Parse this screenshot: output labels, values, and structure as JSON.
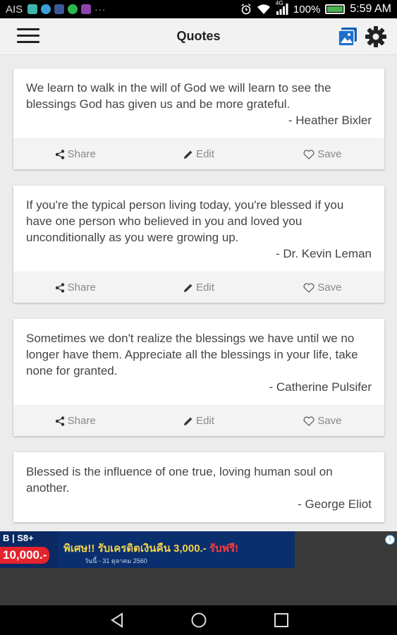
{
  "status_bar": {
    "carrier": "AIS",
    "signal_type": "4G",
    "battery": "100%",
    "time": "5:59 AM"
  },
  "app_bar": {
    "title": "Quotes"
  },
  "actions": {
    "share": "Share",
    "edit": "Edit",
    "save": "Save"
  },
  "quotes": [
    {
      "text": "We learn to walk in the will of God we will learn to see the blessings God has given us and be more grateful.",
      "author": "- Heather Bixler"
    },
    {
      "text": "If you're the typical person living today, you're blessed if you have one person who believed in you and loved you unconditionally as you were growing up.",
      "author": "- Dr. Kevin Leman"
    },
    {
      "text": "Sometimes we don't realize the blessings we have until we no longer have them. Appreciate all the blessings in your life, take none for granted.",
      "author": "- Catherine Pulsifer"
    },
    {
      "text": "Blessed is the influence of one true, loving human soul on another.",
      "author": "- George Eliot"
    }
  ],
  "ad": {
    "tag": "B | S8+",
    "price": "10,000.-",
    "promo_a": "พิเศษ!! รับเครดิตเงินคืน 3,000.-",
    "promo_b": "รับฟรี!",
    "sub": "วันนี้ - 31 ตุลาคม 2560"
  },
  "colors": {
    "app_bar": "#f2f2f2",
    "card_action_bar": "#f3f3f3",
    "accent_blue": "#1e6fc8"
  }
}
